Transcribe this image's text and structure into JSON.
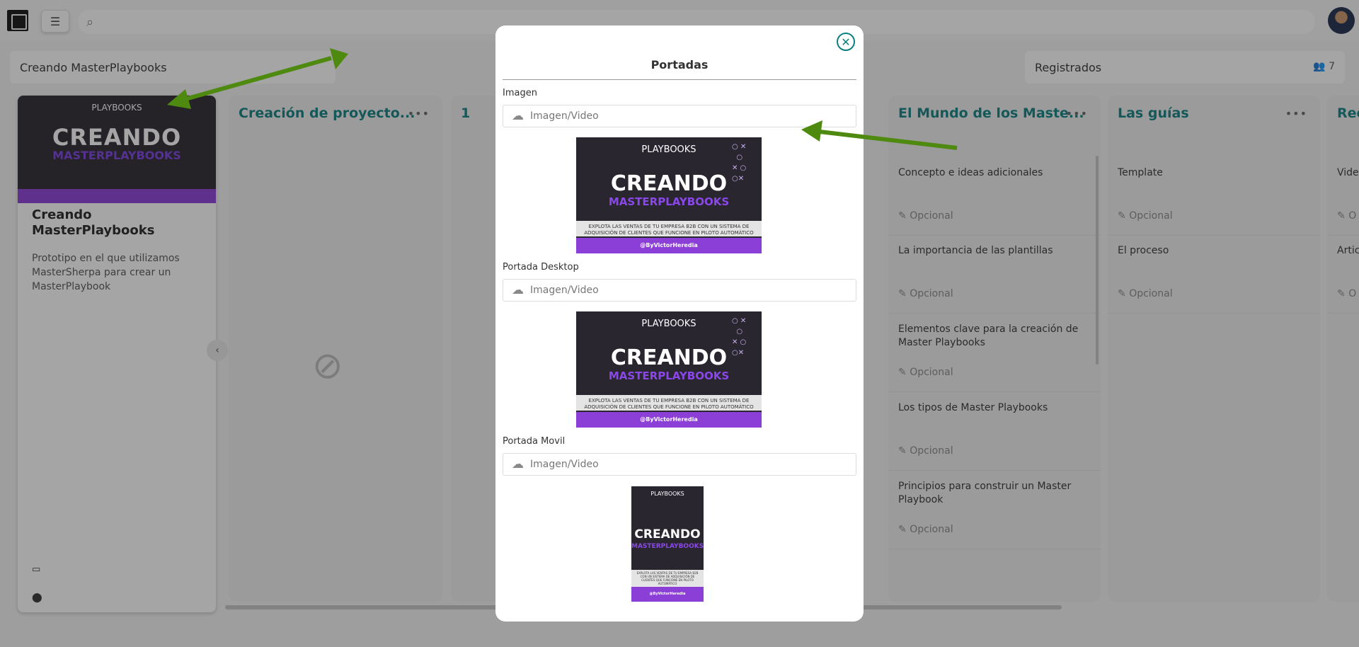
{
  "topbar": {
    "menu_icon": "hamburger-icon",
    "search_icon": "search-icon"
  },
  "header": {
    "project_title": "Creando MasterPlaybooks",
    "registered_label": "Registrados",
    "registered_count": "7"
  },
  "project_card": {
    "cover": {
      "brand": "PLAYBOOKS",
      "line1": "CREANDO",
      "line2": "MASTERPLAYBOOKS"
    },
    "title": "Creando MasterPlaybooks",
    "description": "Prototipo en el que utilizamos MasterSherpa para crear un MasterPlaybook"
  },
  "columns": [
    {
      "title": "Creación de proyecto..."
    },
    {
      "title": "1"
    },
    {
      "title": "El Mundo de los Maste...",
      "tasks": [
        {
          "title": "Concepto e ideas adicionales",
          "status": "Opcional"
        },
        {
          "title": "La importancia de las plantillas",
          "status": "Opcional"
        },
        {
          "title": "Elementos clave para la creación de Master Playbooks",
          "status": "Opcional"
        },
        {
          "title": "Los tipos de Master Playbooks",
          "status": "Opcional"
        },
        {
          "title": "Principios para construir un Master Playbook",
          "status": "Opcional"
        }
      ]
    },
    {
      "title": "Las guías",
      "tasks": [
        {
          "title": "Template",
          "status": "Opcional"
        },
        {
          "title": "El proceso",
          "status": "Opcional"
        }
      ]
    },
    {
      "title": "Rec",
      "tasks": [
        {
          "title": "Vide",
          "status": "O"
        },
        {
          "title": "Artic",
          "status": "O"
        }
      ]
    }
  ],
  "modal": {
    "title": "Portadas",
    "fields": [
      {
        "label": "Imagen",
        "placeholder": "Imagen/Video"
      },
      {
        "label": "Portada Desktop",
        "placeholder": "Imagen/Video"
      },
      {
        "label": "Portada Movil",
        "placeholder": "Imagen/Video"
      }
    ],
    "preview": {
      "brand": "PLAYBOOKS",
      "line1": "CREANDO",
      "line2": "MASTERPLAYBOOKS",
      "tagline": "EXPLOTA LAS VENTAS DE TU EMPRESA B2B CON UN SISTEMA DE ADQUISICIÓN DE CLIENTES QUE FUNCIONE EN PILOTO AUTOMÁTICO",
      "handle": "@ByVictorHeredia"
    }
  },
  "colors": {
    "accent": "#0e7f80",
    "purple": "#8b3fd6",
    "arrow": "#4f8a10"
  }
}
